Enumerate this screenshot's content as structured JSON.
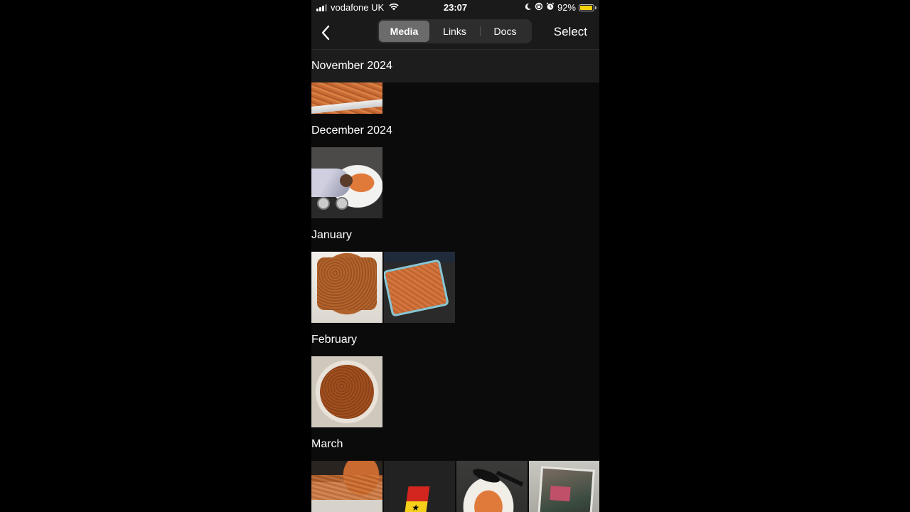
{
  "status_bar": {
    "carrier": "vodafone UK",
    "time": "23:07",
    "battery_percent": "92%",
    "battery_level": 0.92,
    "icons": [
      "signal-icon",
      "wifi-icon",
      "moon-icon",
      "rotation-lock-icon",
      "alarm-icon",
      "battery-icon"
    ]
  },
  "nav": {
    "back_icon": "chevron-left-icon",
    "tabs": [
      {
        "label": "Media",
        "active": true
      },
      {
        "label": "Links",
        "active": false
      },
      {
        "label": "Docs",
        "active": false
      }
    ],
    "select_label": "Select"
  },
  "sections": [
    {
      "title": "November 2024",
      "thumbnails": [
        "rice-plate-photo"
      ]
    },
    {
      "title": "December 2024",
      "thumbnails": [
        "serving-rice-photo"
      ]
    },
    {
      "title": "January",
      "thumbnails": [
        "rice-tray-photo",
        "rice-container-photo"
      ]
    },
    {
      "title": "February",
      "thumbnails": [
        "rice-bowl-photo"
      ]
    },
    {
      "title": "March",
      "thumbnails": [
        "rice-container-photo",
        "ghana-independence-poster",
        "rice-plate-spoon-photo",
        "framed-photo"
      ]
    }
  ],
  "colors": {
    "background": "#0b0b0b",
    "bar": "#1a1a1a",
    "segment_active": "#6b6b6b",
    "battery": "#f5d10b"
  }
}
